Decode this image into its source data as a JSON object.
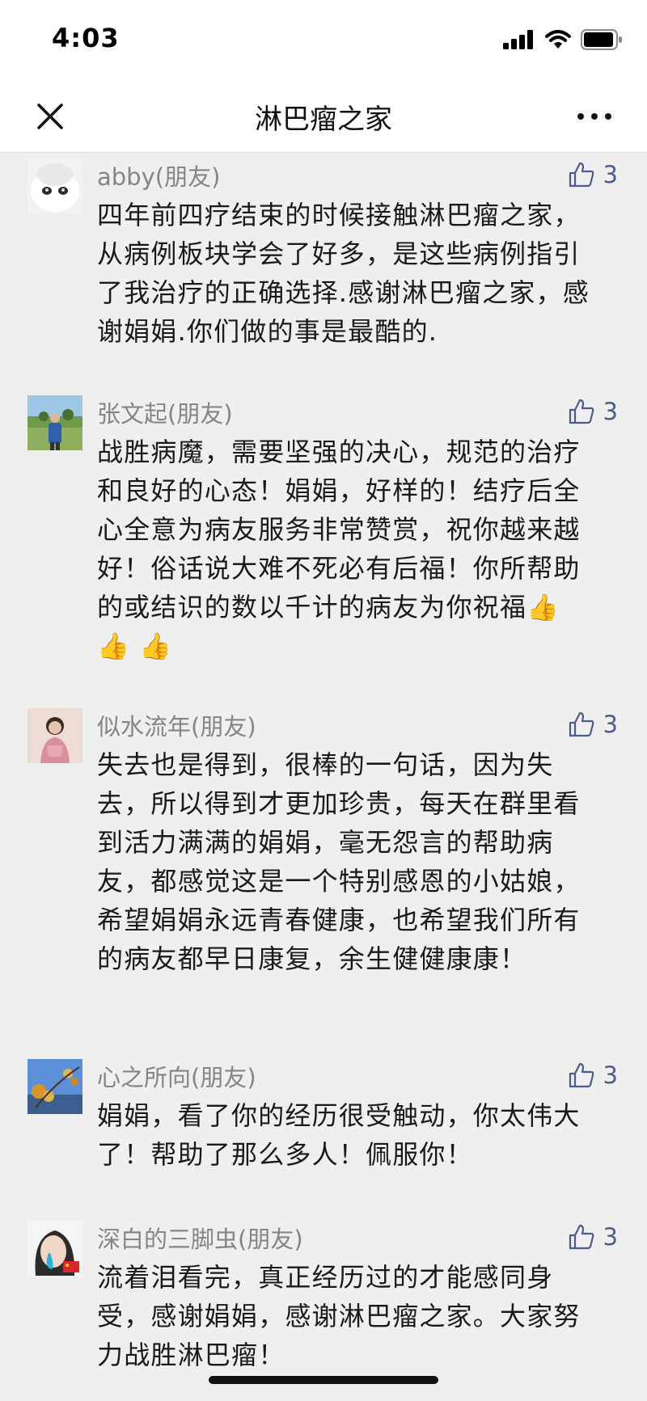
{
  "status": {
    "time": "4:03"
  },
  "nav": {
    "title": "淋巴瘤之家"
  },
  "comments": [
    {
      "author": "abby(朋友)",
      "likes": "3",
      "text": "四年前四疗结束的时候接触淋巴瘤之家，从病例板块学会了好多，是这些病例指引了我治疗的正确选择.感谢淋巴瘤之家，感谢娟娟.你们做的事是最酷的."
    },
    {
      "author": "张文起(朋友)",
      "likes": "3",
      "text": "战胜病魔，需要坚强的决心，规范的治疗和良好的心态！娟娟，好样的！结疗后全心全意为病友服务非常赞赏，祝你越来越好！俗话说大难不死必有后福！你所帮助的或结识的数以千计的病友为你祝福👍 👍 👍"
    },
    {
      "author": "似水流年(朋友)",
      "likes": "3",
      "text": "失去也是得到，很棒的一句话，因为失去，所以得到才更加珍贵，每天在群里看到活力满满的娟娟，毫无怨言的帮助病友，都感觉这是一个特别感恩的小姑娘，希望娟娟永远青春健康，也希望我们所有的病友都早日康复，余生健健康康！"
    },
    {
      "author": "心之所向(朋友)",
      "likes": "3",
      "text": "娟娟，看了你的经历很受触动，你太伟大了！帮助了那么多人！佩服你！"
    },
    {
      "author": "深白的三脚虫(朋友)",
      "likes": "3",
      "text": "流着泪看完，真正经历过的才能感同身受，感谢娟娟，感谢淋巴瘤之家。大家努力战胜淋巴瘤！"
    }
  ],
  "colors": {
    "background": "#efefef",
    "author": "#858585",
    "like": "#4b5d8a"
  }
}
